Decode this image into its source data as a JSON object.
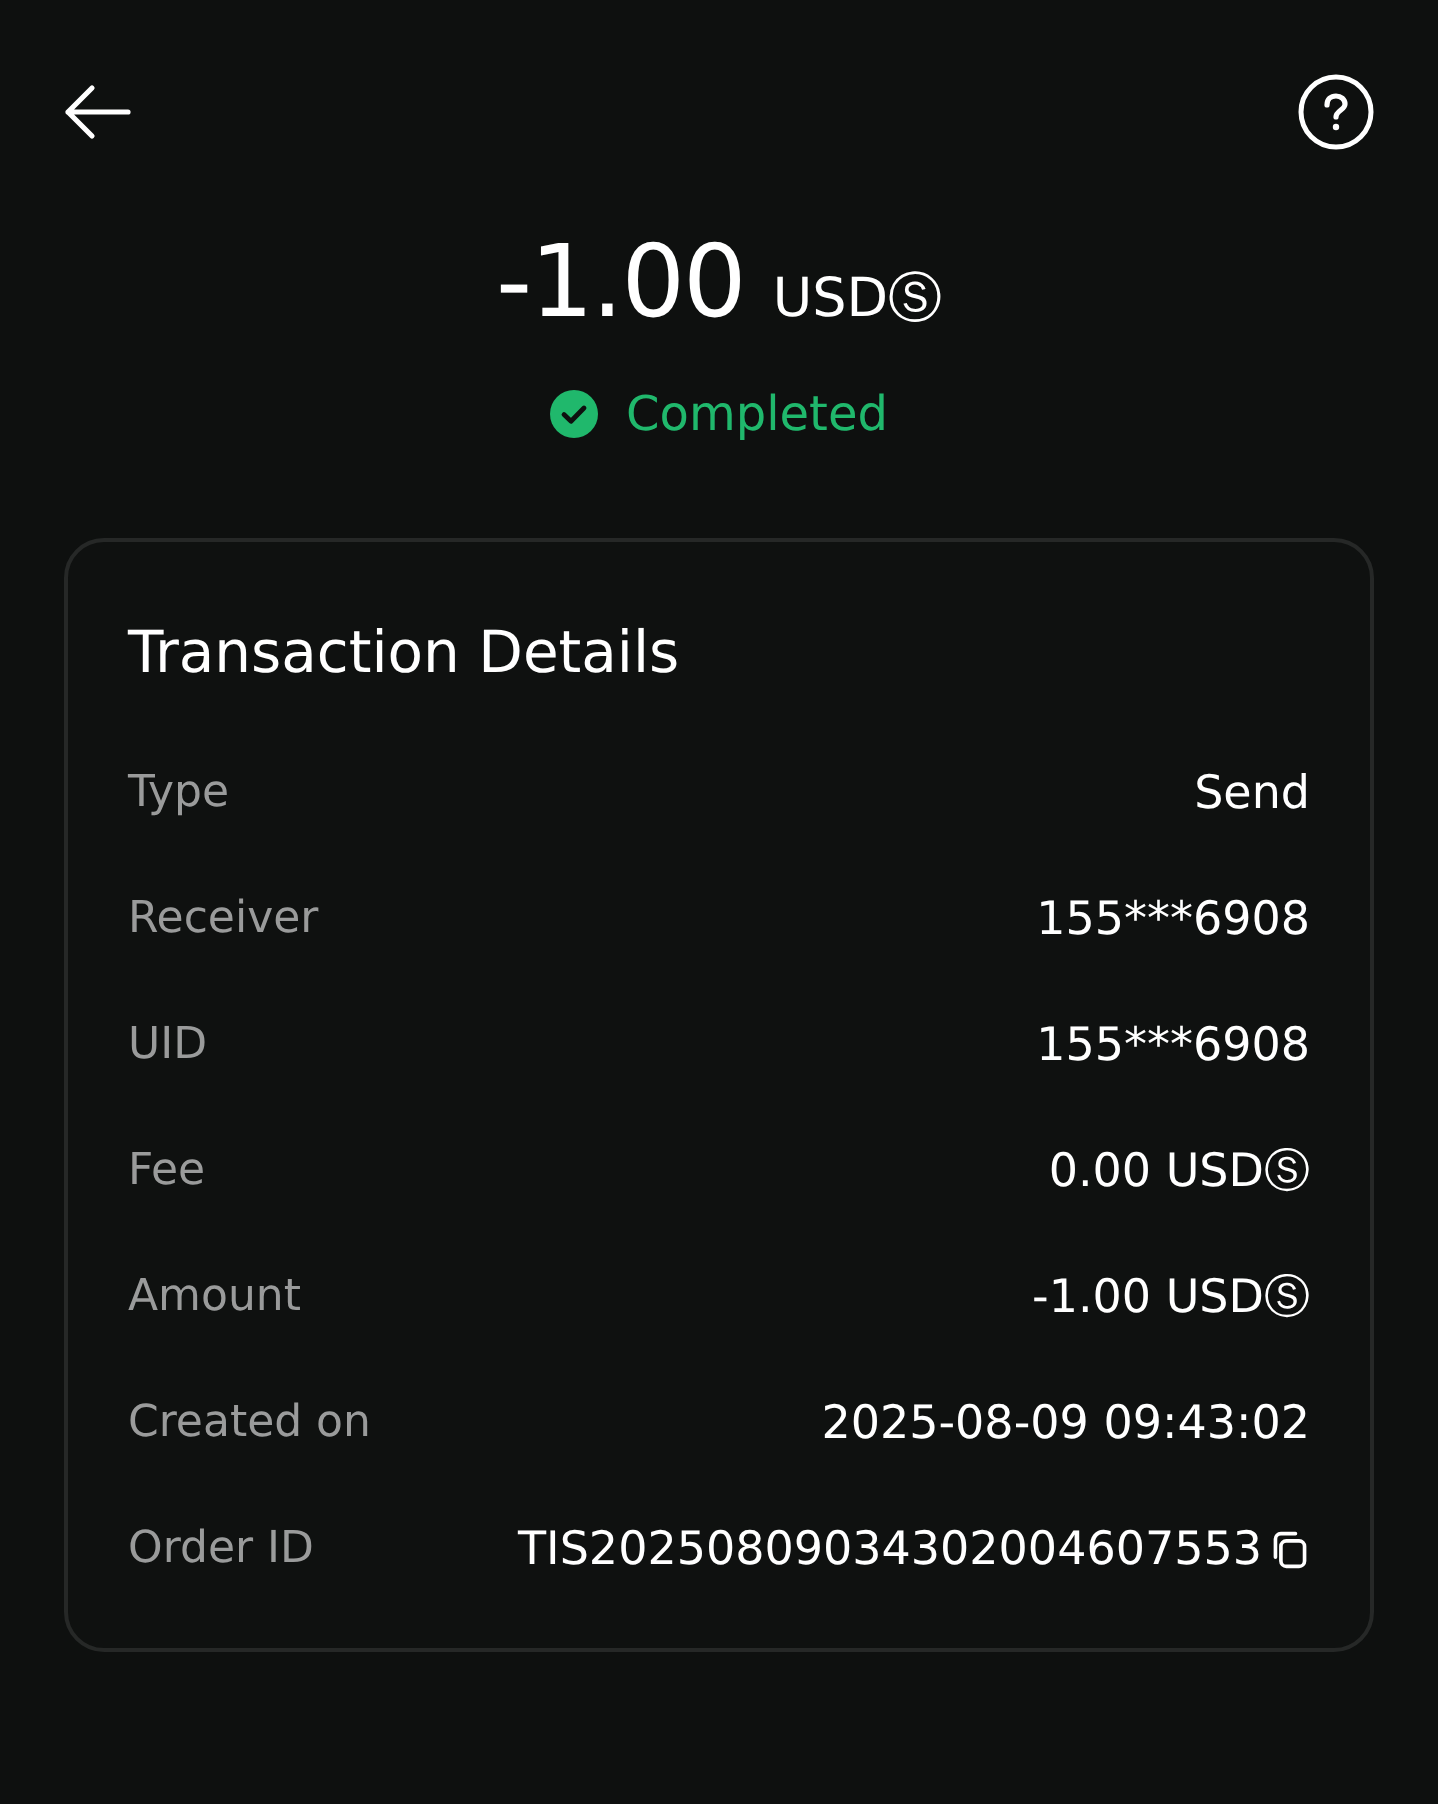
{
  "header": {
    "amount": "-1.00",
    "currency": "USDⓈ"
  },
  "status": {
    "label": "Completed",
    "kind": "success"
  },
  "details": {
    "title": "Transaction Details",
    "rows": [
      {
        "label": "Type",
        "value": "Send",
        "kind": "text"
      },
      {
        "label": "Receiver",
        "value": "155***6908",
        "kind": "text"
      },
      {
        "label": "UID",
        "value": "155***6908",
        "kind": "text"
      },
      {
        "label": "Fee",
        "value": "0.00 USDⓈ",
        "kind": "text"
      },
      {
        "label": "Amount",
        "value": "-1.00 USDⓈ",
        "kind": "text"
      },
      {
        "label": "Created on",
        "value": "2025-08-09 09:43:02",
        "kind": "text"
      },
      {
        "label": "Order ID",
        "value": "TIS20250809034302004607553",
        "kind": "copy"
      }
    ]
  }
}
